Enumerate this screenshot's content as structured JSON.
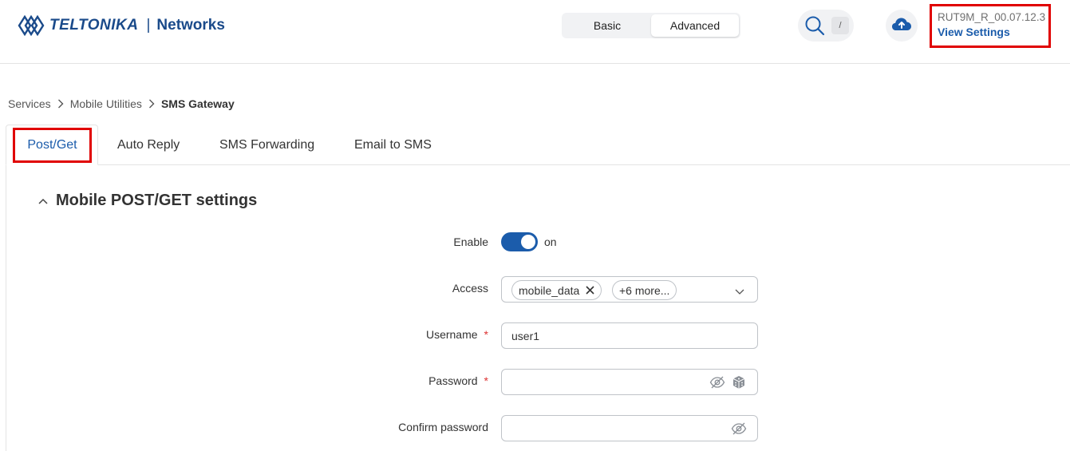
{
  "header": {
    "logo_word": "TELTONIKA",
    "logo_separator": "|",
    "logo_networks": "Networks",
    "mode_basic": "Basic",
    "mode_advanced": "Advanced",
    "active_mode": "Advanced",
    "search_shortcut": "/",
    "device_name": "RUT9M_R_00.07.12.3",
    "view_settings": "View Settings"
  },
  "breadcrumb": [
    "Services",
    "Mobile Utilities",
    "SMS Gateway"
  ],
  "tabs": [
    {
      "label": "Post/Get",
      "active": true
    },
    {
      "label": "Auto Reply",
      "active": false
    },
    {
      "label": "SMS Forwarding",
      "active": false
    },
    {
      "label": "Email to SMS",
      "active": false
    }
  ],
  "section": {
    "title": "Mobile POST/GET settings",
    "fields": {
      "enable": {
        "label": "Enable",
        "state_text": "on",
        "value": true
      },
      "access": {
        "label": "Access",
        "chip": "mobile_data",
        "more": "+6 more..."
      },
      "username": {
        "label": "Username",
        "required_mark": "*",
        "value": "user1"
      },
      "password": {
        "label": "Password",
        "required_mark": "*",
        "value": ""
      },
      "confirm_password": {
        "label": "Confirm password",
        "value": ""
      }
    }
  },
  "colors": {
    "brand_blue": "#1b5cab",
    "highlight_red": "#e00000",
    "required_red": "#d33"
  },
  "icons": [
    "teltonika-logo-icon",
    "search-icon",
    "cloud-upload-icon",
    "chevron-right-icon",
    "chevron-up-icon",
    "close-icon",
    "chevron-down-icon",
    "eye-off-icon",
    "dice-icon"
  ]
}
